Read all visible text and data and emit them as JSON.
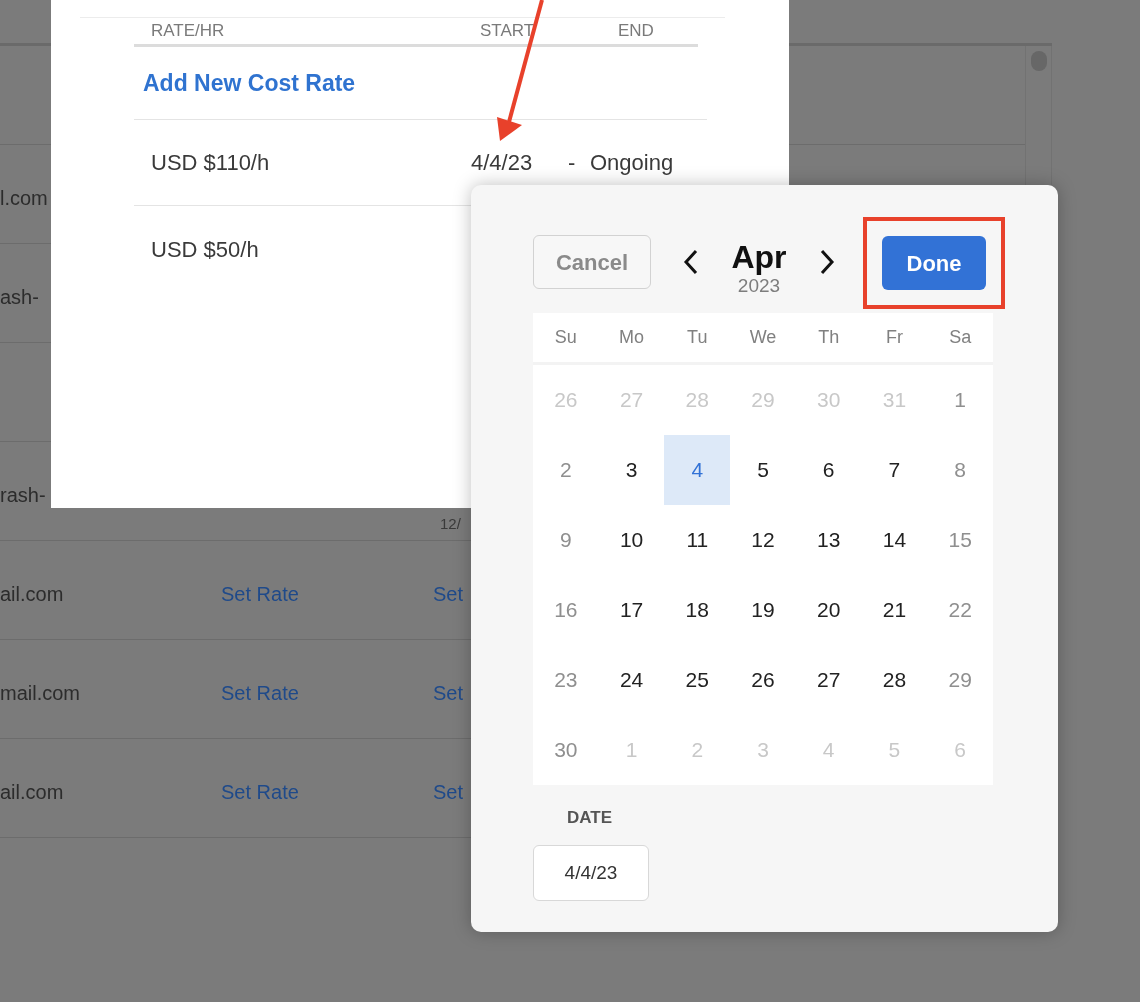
{
  "background_table": {
    "rows": [
      {
        "kind": "empty"
      },
      {
        "kind": "cells",
        "email": "l.com"
      },
      {
        "kind": "cells",
        "email": "ash-"
      },
      {
        "kind": "empty"
      },
      {
        "kind": "cells",
        "email": "rash-",
        "column_3": "12/"
      },
      {
        "kind": "cells",
        "email": "ail.com",
        "column_2": "Set Rate",
        "column_3": "Set"
      },
      {
        "kind": "cells",
        "email": "mail.com",
        "column_2": "Set Rate",
        "column_3": "Set"
      },
      {
        "kind": "cells",
        "email": "ail.com",
        "column_2": "Set Rate",
        "column_3": "Set"
      }
    ]
  },
  "cost_rates_dialog": {
    "columns": [
      "RATE/HR",
      "START",
      "END"
    ],
    "add_link": "Add New Cost Rate",
    "rates": [
      {
        "rate": "USD $110/h",
        "start": "4/4/23",
        "separator": "-",
        "end": "Ongoing"
      },
      {
        "rate": "USD $50/h"
      }
    ]
  },
  "date_picker": {
    "cancel": "Cancel",
    "month": "Apr",
    "year": "2023",
    "done": "Done",
    "done_highlighted": true,
    "weekdays": [
      "Su",
      "Mo",
      "Tu",
      "We",
      "Th",
      "Fr",
      "Sa"
    ],
    "weeks": [
      [
        {
          "label": "26",
          "outside": true,
          "selected": false
        },
        {
          "label": "27",
          "outside": true,
          "selected": false
        },
        {
          "label": "28",
          "outside": true,
          "selected": false
        },
        {
          "label": "29",
          "outside": true,
          "selected": false
        },
        {
          "label": "30",
          "outside": true,
          "selected": false
        },
        {
          "label": "31",
          "outside": true,
          "selected": false
        },
        {
          "label": "1",
          "outside": false,
          "selected": false
        }
      ],
      [
        {
          "label": "2",
          "outside": false,
          "selected": false
        },
        {
          "label": "3",
          "outside": false,
          "selected": false
        },
        {
          "label": "4",
          "outside": false,
          "selected": true
        },
        {
          "label": "5",
          "outside": false,
          "selected": false
        },
        {
          "label": "6",
          "outside": false,
          "selected": false
        },
        {
          "label": "7",
          "outside": false,
          "selected": false
        },
        {
          "label": "8",
          "outside": false,
          "selected": false
        }
      ],
      [
        {
          "label": "9",
          "outside": false,
          "selected": false
        },
        {
          "label": "10",
          "outside": false,
          "selected": false
        },
        {
          "label": "11",
          "outside": false,
          "selected": false
        },
        {
          "label": "12",
          "outside": false,
          "selected": false
        },
        {
          "label": "13",
          "outside": false,
          "selected": false
        },
        {
          "label": "14",
          "outside": false,
          "selected": false
        },
        {
          "label": "15",
          "outside": false,
          "selected": false
        }
      ],
      [
        {
          "label": "16",
          "outside": false,
          "selected": false
        },
        {
          "label": "17",
          "outside": false,
          "selected": false
        },
        {
          "label": "18",
          "outside": false,
          "selected": false
        },
        {
          "label": "19",
          "outside": false,
          "selected": false
        },
        {
          "label": "20",
          "outside": false,
          "selected": false
        },
        {
          "label": "21",
          "outside": false,
          "selected": false
        },
        {
          "label": "22",
          "outside": false,
          "selected": false
        }
      ],
      [
        {
          "label": "23",
          "outside": false,
          "selected": false
        },
        {
          "label": "24",
          "outside": false,
          "selected": false
        },
        {
          "label": "25",
          "outside": false,
          "selected": false
        },
        {
          "label": "26",
          "outside": false,
          "selected": false
        },
        {
          "label": "27",
          "outside": false,
          "selected": false
        },
        {
          "label": "28",
          "outside": false,
          "selected": false
        },
        {
          "label": "29",
          "outside": false,
          "selected": false
        }
      ],
      [
        {
          "label": "30",
          "outside": false,
          "selected": false
        },
        {
          "label": "1",
          "outside": true,
          "selected": false
        },
        {
          "label": "2",
          "outside": true,
          "selected": false
        },
        {
          "label": "3",
          "outside": true,
          "selected": false
        },
        {
          "label": "4",
          "outside": true,
          "selected": false
        },
        {
          "label": "5",
          "outside": true,
          "selected": false
        },
        {
          "label": "6",
          "outside": true,
          "selected": false
        }
      ]
    ],
    "date_label": "DATE",
    "date_value": "4/4/23"
  }
}
